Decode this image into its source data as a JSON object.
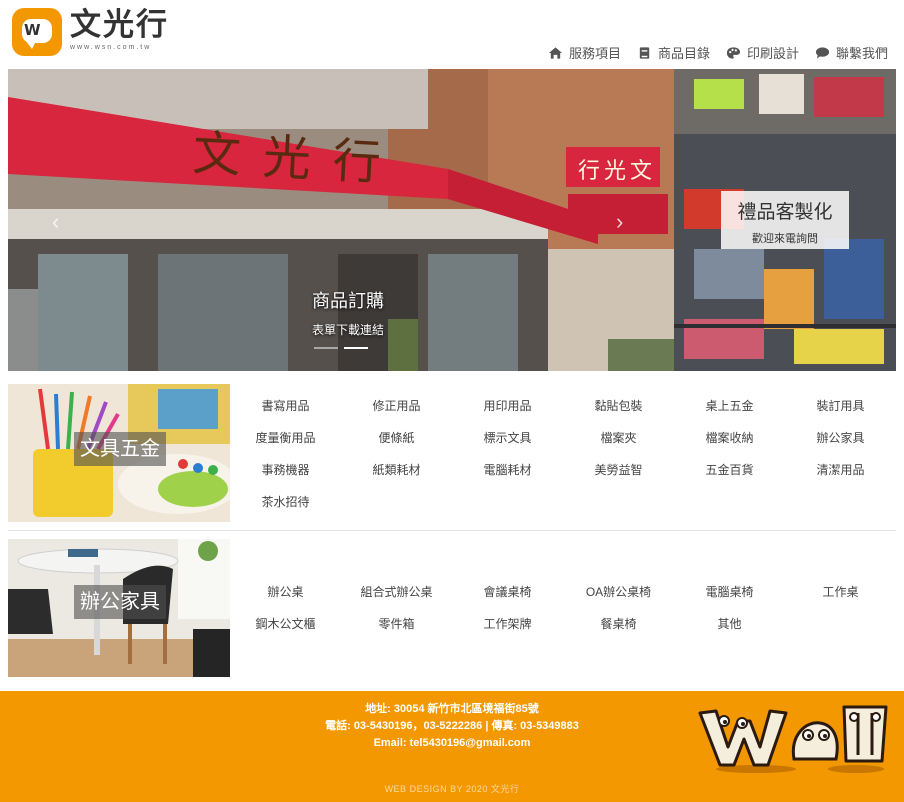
{
  "header": {
    "logo_title": "文光行",
    "logo_url": "www.wsn.com.tw",
    "logo_letter": "W"
  },
  "nav": [
    {
      "label": "服務項目",
      "icon": "home-icon"
    },
    {
      "label": "商品目錄",
      "icon": "book-icon"
    },
    {
      "label": "印刷設計",
      "icon": "palette-icon"
    },
    {
      "label": "聯繫我們",
      "icon": "chat-icon"
    }
  ],
  "slider": {
    "store_sign": "文光行",
    "store_sign_small": "行光文",
    "caption_title": "商品訂購",
    "caption_sub": "表單下載連結",
    "side_title": "禮品客製化",
    "side_sub": "歡迎來電詢問",
    "prev_icon": "chevron-left-icon",
    "next_icon": "chevron-right-icon"
  },
  "stationery": {
    "label": "文具五金",
    "items": [
      "書寫用品",
      "修正用品",
      "用印用品",
      "黏貼包裝",
      "桌上五金",
      "裝訂用具",
      "度量衡用品",
      "便條紙",
      "標示文具",
      "檔案夾",
      "檔案收納",
      "辦公家具",
      "事務機器",
      "紙類耗材",
      "電腦耗材",
      "美勞益智",
      "五金百貨",
      "清潔用品",
      "茶水招待"
    ]
  },
  "furniture": {
    "label": "辦公家具",
    "items": [
      "辦公桌",
      "組合式辦公桌",
      "會議桌椅",
      "OA辦公桌椅",
      "電腦桌椅",
      "工作桌",
      "鋼木公文櫃",
      "零件箱",
      "工作架牌",
      "餐桌椅",
      "其他"
    ]
  },
  "footer": {
    "address": "地址: 30054 新竹市北區境福街85號",
    "phone": "電話: 03-5430196，03-5222286 | 傳真: 03-5349883",
    "email": "Email: tel5430196@gmail.com",
    "credit": "WEB DESIGN BY 2020 文光行",
    "mascot_text": "Wa"
  },
  "colors": {
    "brand_orange": "#f39800",
    "sign_red": "#d7263d",
    "text_gray": "#444444"
  }
}
